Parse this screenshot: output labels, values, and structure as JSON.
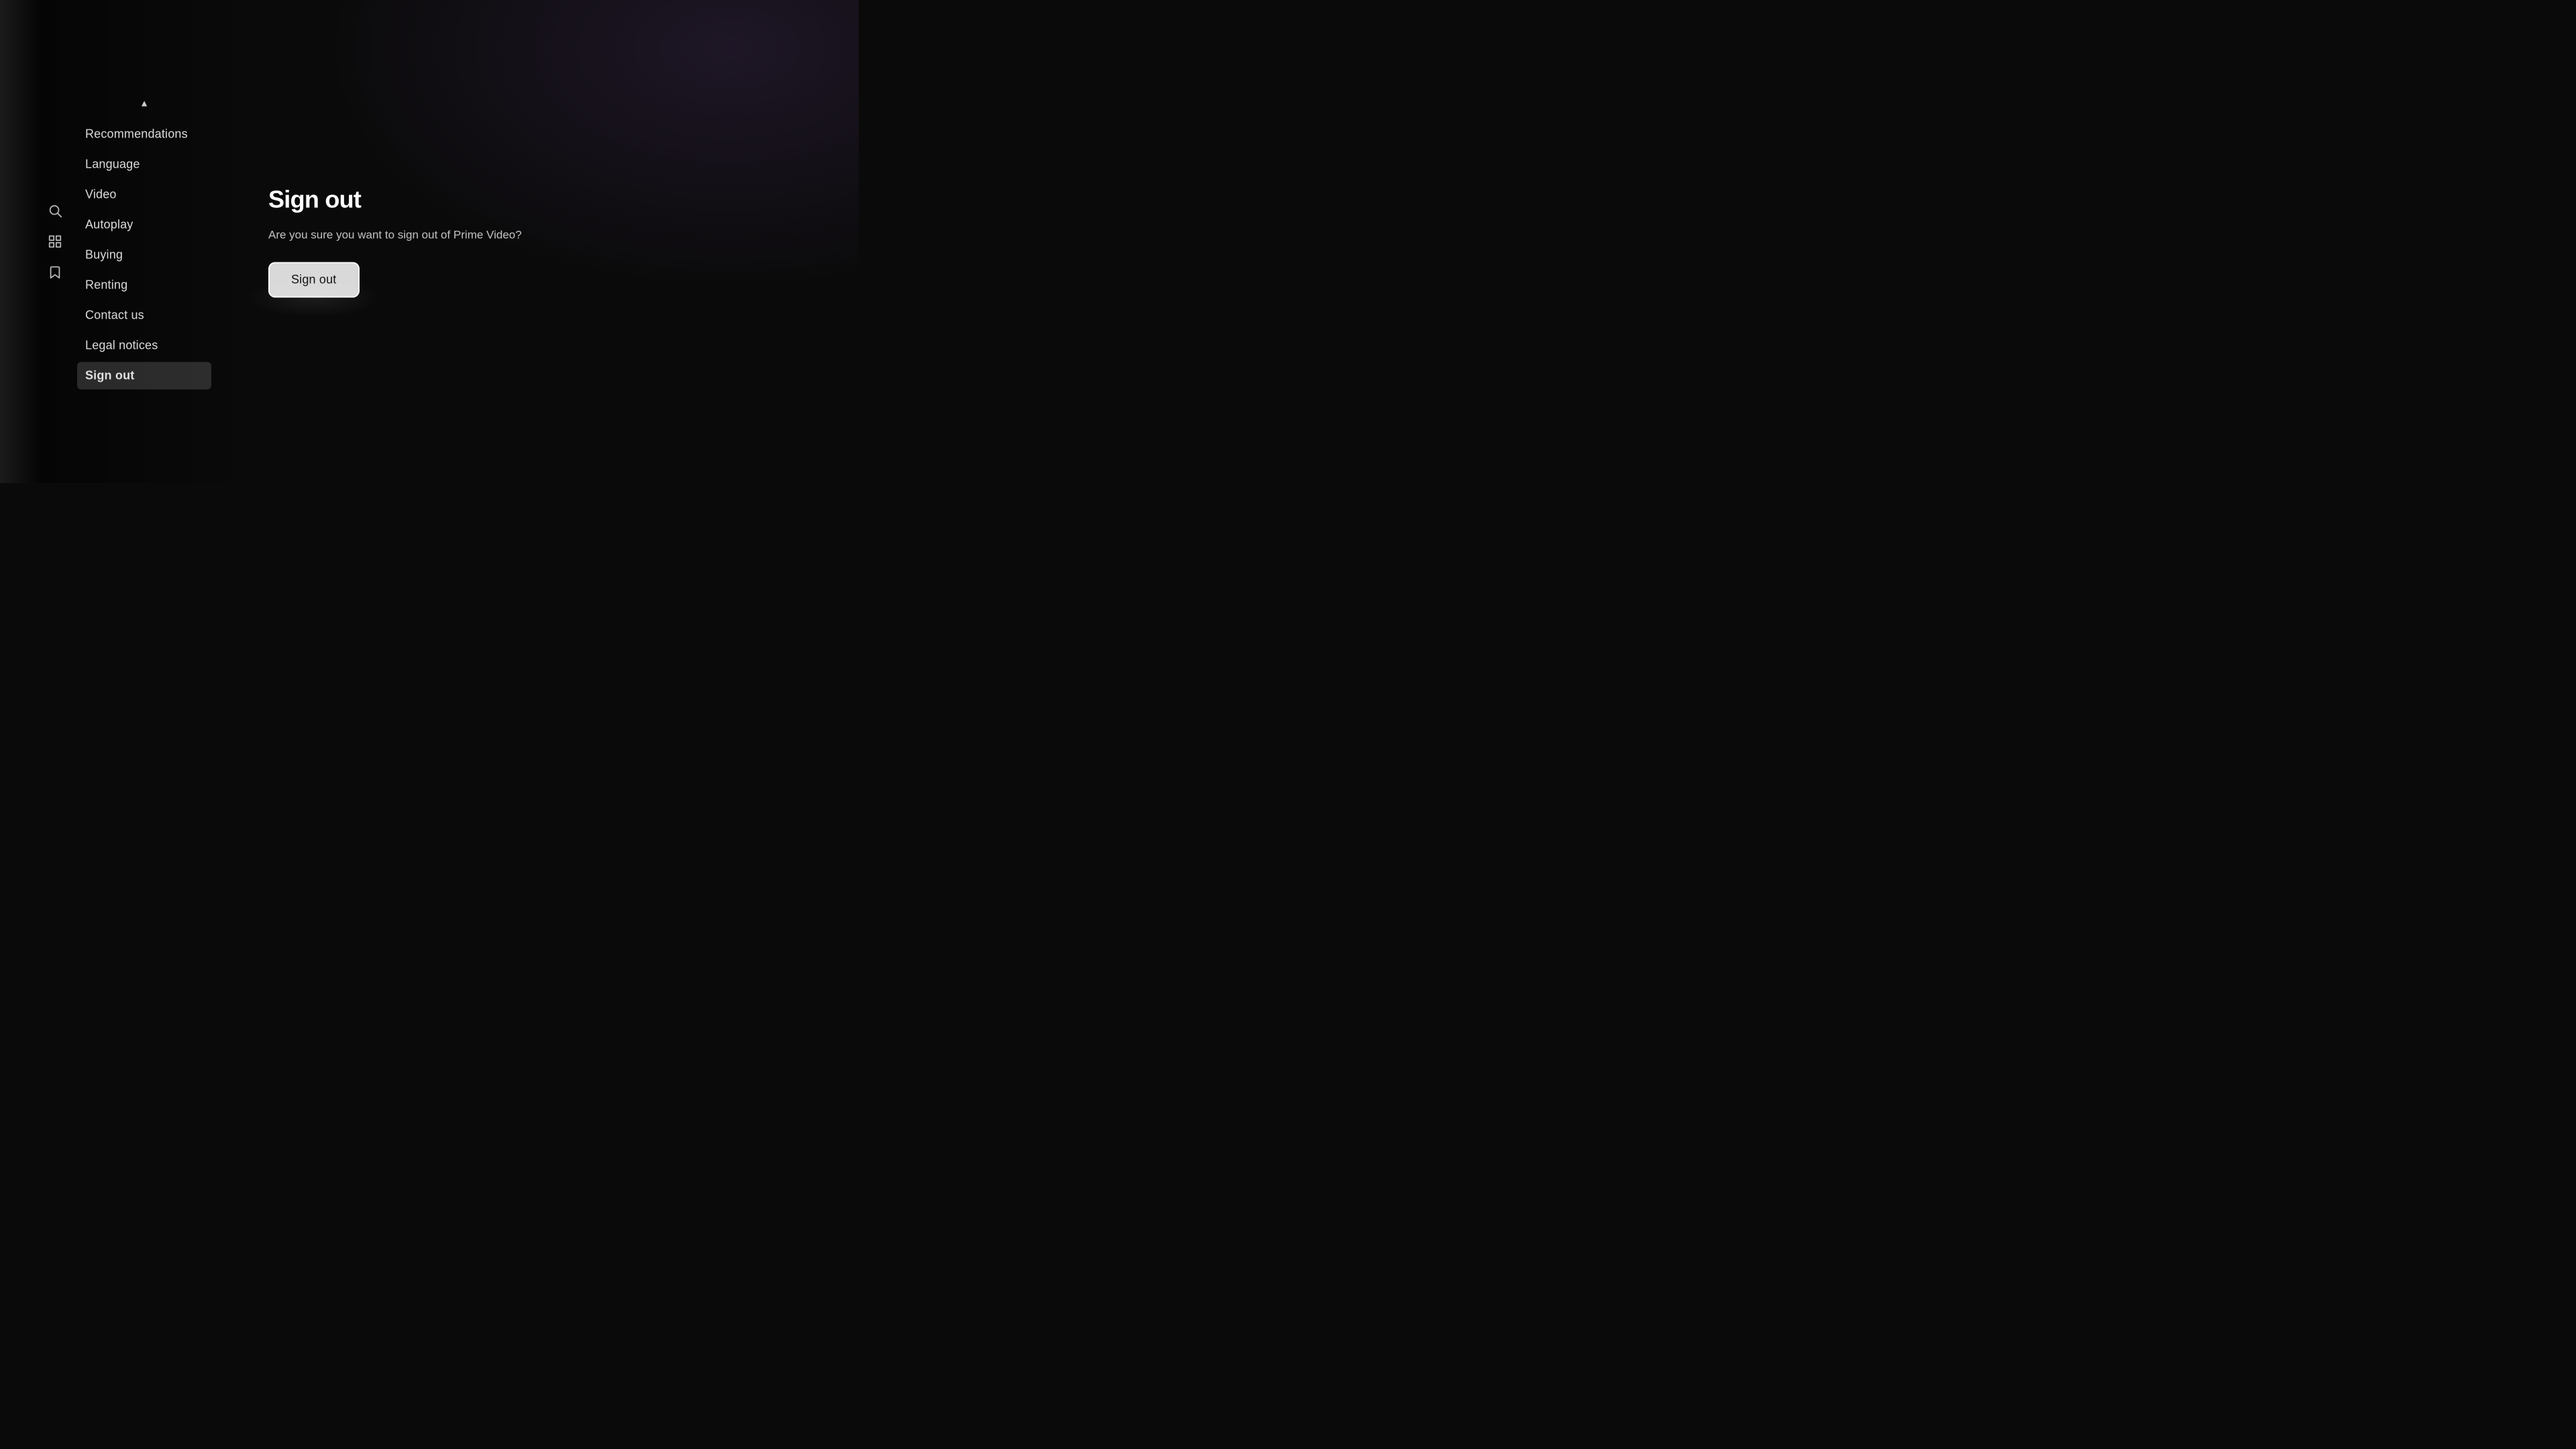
{
  "background": {
    "color": "#0a0a0a"
  },
  "sidebar": {
    "icons": [
      {
        "name": "search-icon",
        "symbol": "search"
      },
      {
        "name": "grid-icon",
        "symbol": "grid"
      },
      {
        "name": "bookmark-icon",
        "symbol": "bookmark"
      }
    ]
  },
  "menu": {
    "arrow_label": "▲",
    "items": [
      {
        "id": "recommendations",
        "label": "Recommendations",
        "active": false
      },
      {
        "id": "language",
        "label": "Language",
        "active": false
      },
      {
        "id": "video",
        "label": "Video",
        "active": false
      },
      {
        "id": "autoplay",
        "label": "Autoplay",
        "active": false
      },
      {
        "id": "buying",
        "label": "Buying",
        "active": false
      },
      {
        "id": "renting",
        "label": "Renting",
        "active": false
      },
      {
        "id": "contact-us",
        "label": "Contact us",
        "active": false
      },
      {
        "id": "legal-notices",
        "label": "Legal notices",
        "active": false
      },
      {
        "id": "sign-out",
        "label": "Sign out",
        "active": true
      }
    ]
  },
  "panel": {
    "title": "Sign out",
    "description": "Are you sure you want to sign out of Prime Video?",
    "confirm_button_label": "Sign out"
  }
}
